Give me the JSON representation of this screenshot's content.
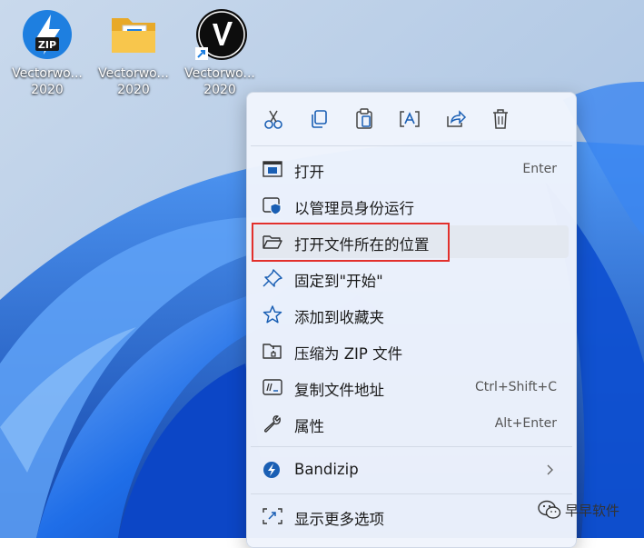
{
  "desktop": {
    "icons": [
      {
        "label_line1": "Vectorwo...",
        "label_line2": "2020",
        "icon": "zip-archive-icon"
      },
      {
        "label_line1": "Vectorwo...",
        "label_line2": "2020",
        "icon": "folder-icon"
      },
      {
        "label_line1": "Vectorwo...",
        "label_line2": "2020",
        "icon": "vectorworks-shortcut-icon"
      }
    ],
    "zip_badge": "ZIP"
  },
  "context_menu": {
    "toolbar": [
      {
        "icon": "cut-icon"
      },
      {
        "icon": "copy-icon"
      },
      {
        "icon": "paste-icon"
      },
      {
        "icon": "rename-icon"
      },
      {
        "icon": "share-icon"
      },
      {
        "icon": "delete-icon"
      }
    ],
    "items": [
      {
        "label": "打开",
        "shortcut": "Enter",
        "icon": "open-window-icon"
      },
      {
        "label": "以管理员身份运行",
        "shortcut": "",
        "icon": "shield-icon"
      },
      {
        "label": "打开文件所在的位置",
        "shortcut": "",
        "icon": "folder-open-icon"
      },
      {
        "label": "固定到\"开始\"",
        "shortcut": "",
        "icon": "pin-icon"
      },
      {
        "label": "添加到收藏夹",
        "shortcut": "",
        "icon": "star-icon"
      },
      {
        "label": "压缩为 ZIP 文件",
        "shortcut": "",
        "icon": "zip-folder-icon"
      },
      {
        "label": "复制文件地址",
        "shortcut": "Ctrl+Shift+C",
        "icon": "copy-path-icon"
      },
      {
        "label": "属性",
        "shortcut": "Alt+Enter",
        "icon": "wrench-icon"
      }
    ],
    "bandizip": {
      "label": "Bandizip",
      "icon": "bandizip-icon"
    },
    "more": {
      "label": "显示更多选项",
      "icon": "more-options-icon"
    }
  },
  "watermark": {
    "text": "早早软件"
  },
  "colors": {
    "highlight_border": "#e2302c",
    "accent": "#0067c0"
  }
}
